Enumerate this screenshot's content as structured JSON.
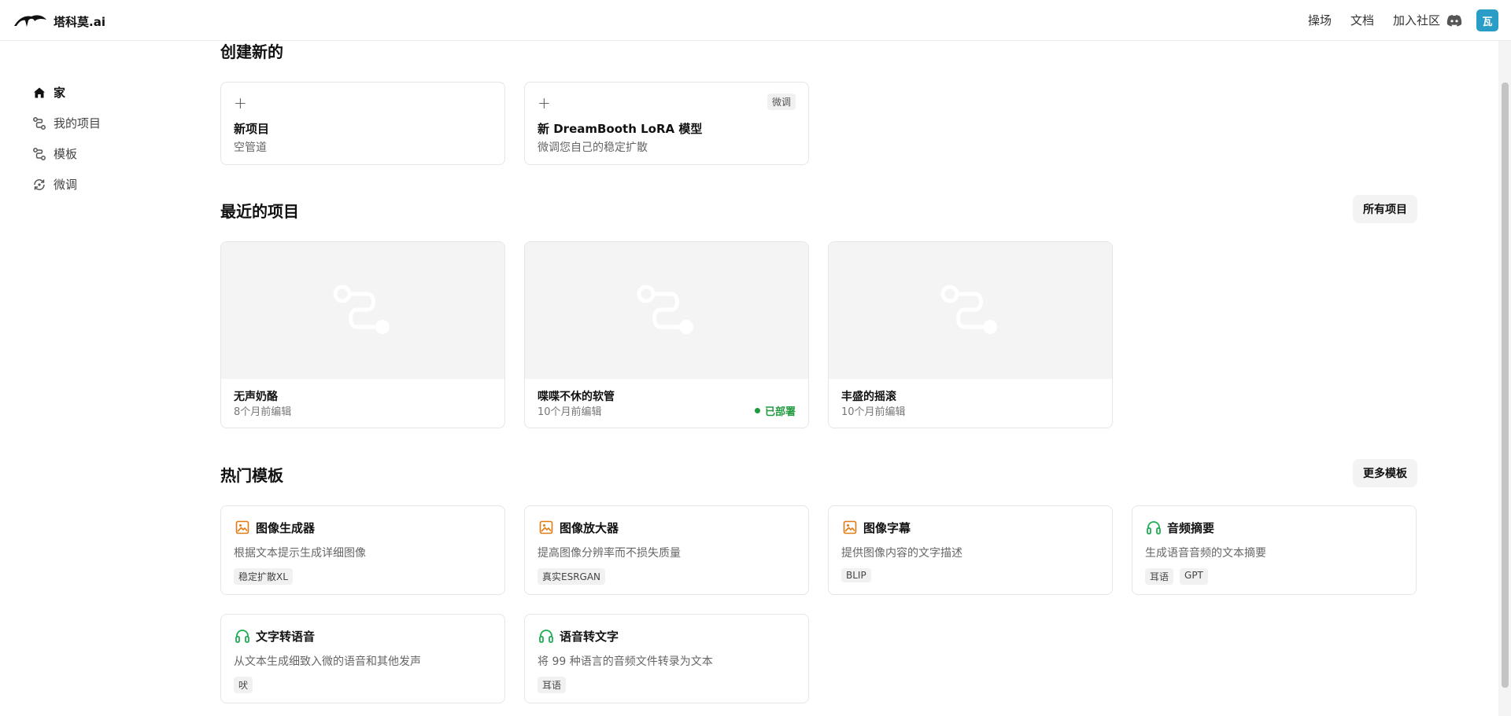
{
  "header": {
    "brand": "塔科莫.ai",
    "nav": [
      "操场",
      "文档",
      "加入社区"
    ],
    "avatar_initial": "瓦",
    "avatar_color": "#2a9dc6"
  },
  "sidebar": {
    "items": [
      {
        "label": "家",
        "icon": "home-icon",
        "active": true
      },
      {
        "label": "我的项目",
        "icon": "pipeline-icon"
      },
      {
        "label": "模板",
        "icon": "pipeline-icon"
      },
      {
        "label": "微调",
        "icon": "refresh-icon"
      }
    ]
  },
  "create_section": {
    "title": "创建新的",
    "cards": [
      {
        "title": "新项目",
        "subtitle": "空管道"
      },
      {
        "title": "新 DreamBooth LoRA 模型",
        "subtitle": "微调您自己的稳定扩散",
        "badge": "微调"
      }
    ]
  },
  "recent_section": {
    "title": "最近的项目",
    "all_button": "所有项目",
    "projects": [
      {
        "name": "无声奶酪",
        "edited": "8个月前编辑"
      },
      {
        "name": "喋喋不休的软管",
        "edited": "10个月前编辑",
        "status": "已部署"
      },
      {
        "name": "丰盛的摇滚",
        "edited": "10个月前编辑"
      }
    ]
  },
  "templates_section": {
    "title": "热门模板",
    "more_button": "更多模板",
    "templates": [
      {
        "title": "图像生成器",
        "description": "根据文本提示生成详细图像",
        "icon": "image-icon",
        "tags": [
          "稳定扩散XL"
        ]
      },
      {
        "title": "图像放大器",
        "description": "提高图像分辨率而不损失质量",
        "icon": "image-icon",
        "tags": [
          "真实ESRGAN"
        ]
      },
      {
        "title": "图像字幕",
        "description": "提供图像内容的文字描述",
        "icon": "image-icon",
        "tags": [
          "BLIP"
        ]
      },
      {
        "title": "音频摘要",
        "description": "生成语音音频的文本摘要",
        "icon": "headphones-icon",
        "tags": [
          "耳语",
          "GPT"
        ]
      },
      {
        "title": "文字转语音",
        "description": "从文本生成细致入微的语音和其他发声",
        "icon": "headphones-icon",
        "tags": [
          "吠"
        ]
      },
      {
        "title": "语音转文字",
        "description": "将 99 种语言的音频文件转录为文本",
        "icon": "headphones-icon",
        "tags": [
          "耳语"
        ]
      }
    ]
  },
  "colors": {
    "image_icon": "#e07a12",
    "audio_icon": "#1fae54",
    "deployed": "#1f9a3e"
  }
}
